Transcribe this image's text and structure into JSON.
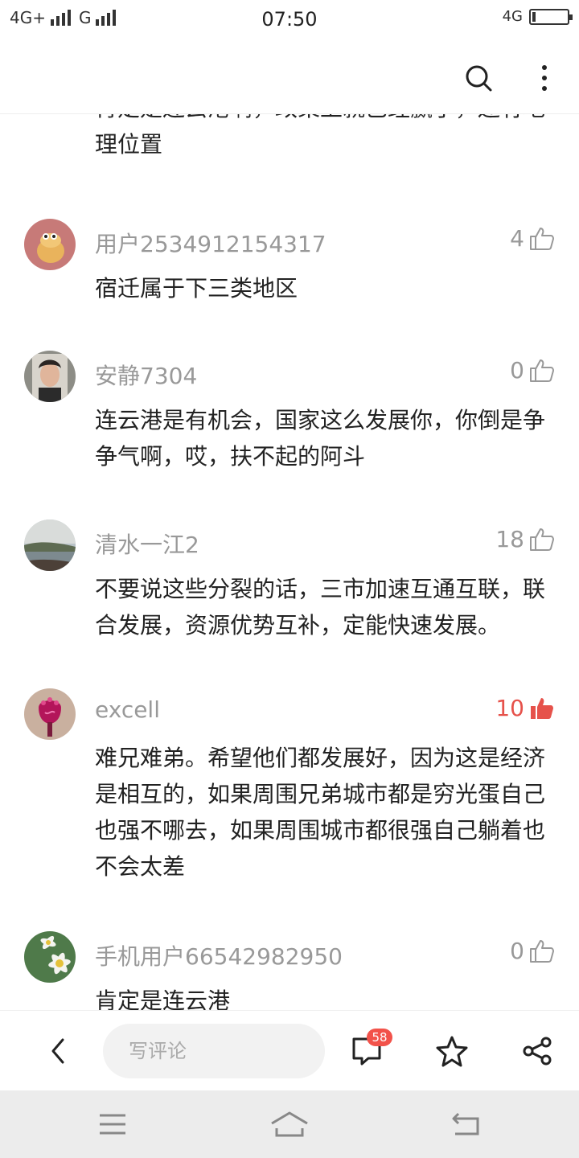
{
  "status_bar": {
    "network_1": "4G+",
    "network_2": "G",
    "time": "07:50",
    "network_right": "4G"
  },
  "header": {
    "search_icon": "search-icon",
    "more_icon": "more-vertical-icon"
  },
  "partial_top_comment": {
    "text": "肯定是连云港啊，政策上就已经赢了，还有地理位置"
  },
  "comments": [
    {
      "username": "用户2534912154317",
      "likes": "4",
      "liked": false,
      "text": "宿迁属于下三类地区"
    },
    {
      "username": "安静7304",
      "likes": "0",
      "liked": false,
      "text": "连云港是有机会，国家这么发展你，你倒是争争气啊，哎，扶不起的阿斗"
    },
    {
      "username": "清水一江2",
      "likes": "18",
      "liked": false,
      "text": "不要说这些分裂的话，三市加速互通互联，联合发展，资源优势互补，定能快速发展。"
    },
    {
      "username": "excell",
      "likes": "10",
      "liked": true,
      "text": "难兄难弟。希望他们都发展好，因为这是经济是相互的，如果周围兄弟城市都是穷光蛋自己也强不哪去，如果周围城市都很强自己躺着也不会太差"
    },
    {
      "username": "手机用户66542982950",
      "likes": "0",
      "liked": false,
      "text": "肯定是连云港"
    }
  ],
  "bottom_bar": {
    "comment_placeholder": "写评论",
    "comment_count": "58"
  },
  "colors": {
    "accent_like": "#e6524b",
    "badge": "#f2524a",
    "muted_text": "#999999"
  }
}
